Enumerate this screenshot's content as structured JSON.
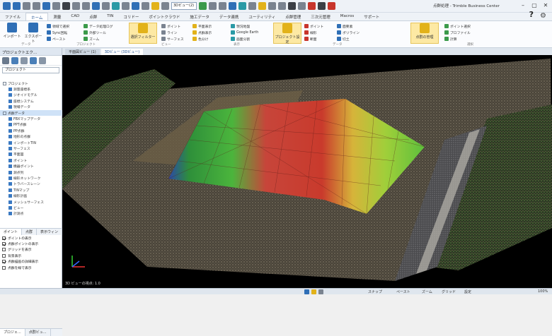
{
  "app": {
    "title": "点群処理 - Trimble Business Center",
    "quick_select": "3Dビュー(2)"
  },
  "window": {
    "min": "–",
    "max": "▢",
    "close": "✕"
  },
  "tabs": [
    "ファイル",
    "ホーム",
    "測量",
    "CAD",
    "点群",
    "TIN",
    "コリドー",
    "ポイントクラウド",
    "施工データ",
    "データ連携",
    "ユーティリティ",
    "点群管理",
    "三次元管理",
    "Macros",
    "サポート"
  ],
  "active_tab_index": 1,
  "ribbon": {
    "large_buttons": [
      {
        "label": "インポート",
        "color": "#2f6fb6"
      },
      {
        "label": "エクスポート",
        "color": "#2f6fb6"
      },
      {
        "label": "選択フィルター",
        "color": "#e2b21a"
      },
      {
        "label": "プロジェクト設定",
        "color": "#e2b21a"
      },
      {
        "label": "点群の管理",
        "color": "#e2b21a"
      }
    ],
    "small_buttons": [
      [
        "領域で選択",
        "Sync回転",
        "ペースト"
      ],
      [
        "データ処理ログ",
        "外部ツール",
        "ズーム"
      ],
      [
        "ポイント",
        "ライン",
        "サーフェス"
      ],
      [
        "平面表示",
        "点群表示",
        "色分け"
      ],
      [
        "現況地盤",
        "Google Earth",
        "画面分割"
      ],
      [
        "ポイント",
        "線形",
        "断面"
      ],
      [
        "面要素",
        "ポリライン",
        "切土"
      ],
      [
        "ポイント選択",
        "プロファイル",
        "計算"
      ]
    ],
    "group_labels": [
      "データ",
      "プロジェクト",
      "ビュー",
      "表示",
      "データ",
      "選択"
    ]
  },
  "sidebar": {
    "title": "プロジェクトエク...",
    "search": "プロジェクト",
    "tree": [
      "プロジェクト",
      "測量座標系",
      "ジオイドモデル",
      "座標システム",
      "現場データ",
      "点群データ",
      "FBXマップデータ",
      "PPT点群",
      "PP点群",
      "地形の点群",
      "インポートTIN",
      "サーフェス",
      "平面図",
      "ポイント",
      "機器ポイント",
      "測点列",
      "線形ネットワーク",
      "トラバースレーン",
      "TINマップ",
      "線形計画",
      "メッシュサーフェス",
      "ビュー",
      "計測点"
    ],
    "selected_tree_index": 5,
    "tabs": [
      "ポイント",
      "点群",
      "表示ウィン"
    ],
    "props": [
      {
        "label": "ポイントの表示",
        "on": true
      },
      {
        "label": "点群ポイントの表示",
        "on": true
      },
      {
        "label": "グリッドを表示",
        "on": false
      },
      {
        "label": "背景表示",
        "on": false
      },
      {
        "label": "点群描画の詳細表示",
        "on": true
      },
      {
        "label": "点群を線で表示",
        "on": false
      }
    ],
    "bottom_tabs": [
      "プロジェ...",
      "点群ビュ..."
    ]
  },
  "doc_tabs": [
    "平面図ビュー (1)",
    "3Dビュー (3Dビュー)"
  ],
  "active_doc_tab": 1,
  "viewport": {
    "status": "3D ビューの視点: 1.0"
  },
  "statusbar": {
    "left": "",
    "right": [
      "スナップ",
      "ペースト",
      "ズーム",
      "グリッド",
      "設定",
      "100%"
    ]
  }
}
